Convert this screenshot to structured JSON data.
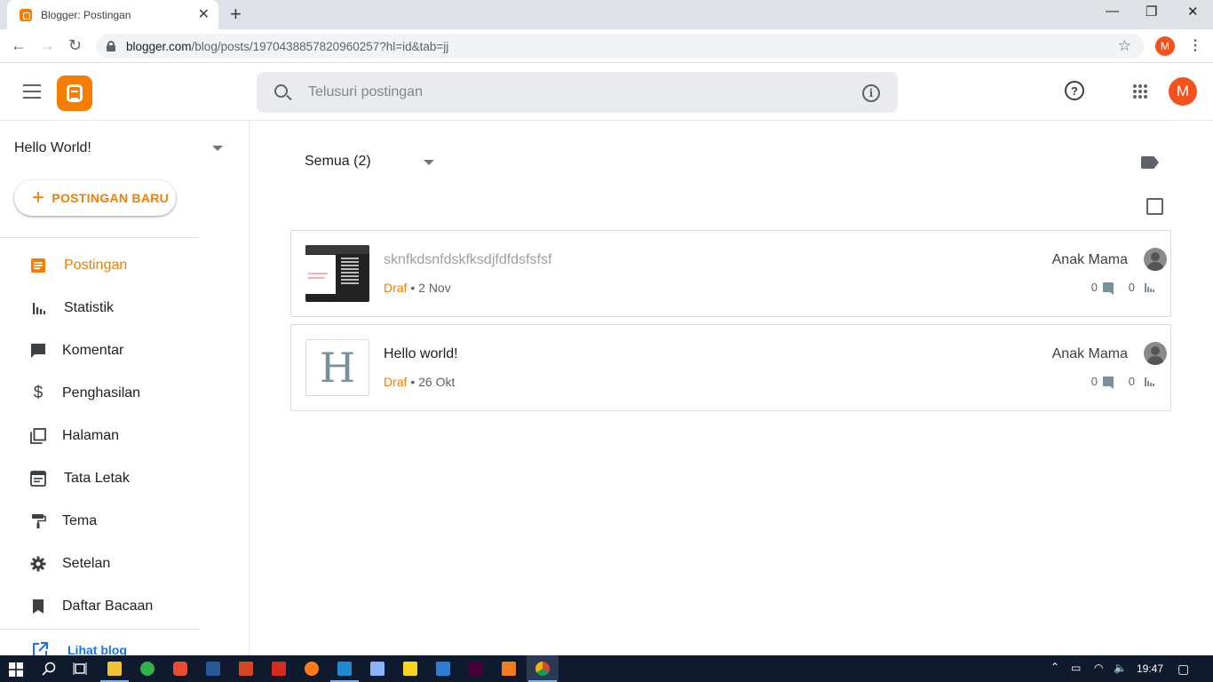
{
  "browser": {
    "tab_title": "Blogger: Postingan",
    "tab_close": "✕",
    "new_tab": "+",
    "url_host": "blogger.com",
    "url_path": "/blog/posts/1970438857820960257?hl=id&tab=jj",
    "profile_initial": "M",
    "window_controls": [
      "—",
      "❐",
      "✕"
    ]
  },
  "header": {
    "search_placeholder": "Telusuri postingan",
    "help_icon": "?",
    "info_icon": "i",
    "avatar_initial": "M"
  },
  "sidebar": {
    "blog_name": "Hello World!",
    "new_post_label": "POSTINGAN BARU",
    "new_post_icon": "+",
    "items": [
      {
        "label": "Postingan",
        "icon": "posts-icon",
        "active": true
      },
      {
        "label": "Statistik",
        "icon": "stats-icon"
      },
      {
        "label": "Komentar",
        "icon": "comment-icon"
      },
      {
        "label": "Penghasilan",
        "icon": "dollar-icon"
      },
      {
        "label": "Halaman",
        "icon": "pages-icon"
      },
      {
        "label": "Tata Letak",
        "icon": "layout-icon"
      },
      {
        "label": "Tema",
        "icon": "paint-roller-icon"
      },
      {
        "label": "Setelan",
        "icon": "gear-icon"
      },
      {
        "label": "Daftar Bacaan",
        "icon": "bookmark-icon"
      }
    ],
    "view_blog_label": "Lihat blog"
  },
  "main": {
    "filter_label": "Semua (2)",
    "posts": [
      {
        "title": "sknfkdsnfdskfksdjfdfdsfsfsf",
        "status": "Draf",
        "date": "2 Nov",
        "author": "Anak Mama",
        "comments": "0",
        "views": "0",
        "thumbnail": "screenshot"
      },
      {
        "title": "Hello world!",
        "status": "Draf",
        "date": "26 Okt",
        "author": "Anak Mama",
        "comments": "0",
        "views": "0",
        "thumbnail": "H"
      }
    ]
  },
  "taskbar": {
    "time": "19:47"
  },
  "colors": {
    "accent": "#f57d00",
    "avatar": "#f4511e",
    "taskbar": "#0f1b2d"
  }
}
